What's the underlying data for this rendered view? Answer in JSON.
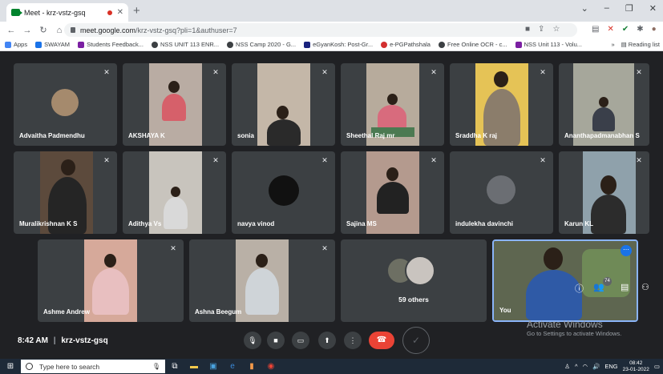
{
  "browser": {
    "tab_title": "Meet - krz-vstz-gsq",
    "url_main": "meet.google.com",
    "url_tail": "/krz-vstz-gsq?pli=1&authuser=7",
    "window_controls": [
      "⌄",
      "–",
      "❐",
      "✕"
    ],
    "bookmarks": [
      {
        "label": "Apps",
        "color": "#4285f4"
      },
      {
        "label": "SWAYAM",
        "color": "#1a73e8"
      },
      {
        "label": "Students Feedback...",
        "color": "#7b1fa2"
      },
      {
        "label": "NSS UNIT 113 ENR...",
        "color": "#3c4043"
      },
      {
        "label": "NSS Camp 2020 - G...",
        "color": "#3c4043"
      },
      {
        "label": "eGyanKosh: Post-Gr...",
        "color": "#1a237e"
      },
      {
        "label": "e-PGPathshala",
        "color": "#d32f2f"
      },
      {
        "label": "Free Online OCR - c...",
        "color": "#3c4043"
      },
      {
        "label": "NSS Unit 113 - Volu...",
        "color": "#7b1fa2"
      }
    ],
    "bookmarks_more": "»",
    "reading_list": "Reading list"
  },
  "participants": [
    {
      "name": "Advaitha Padmendhu"
    },
    {
      "name": "AKSHAYA K"
    },
    {
      "name": "sonia"
    },
    {
      "name": "Sheethal Raj mr"
    },
    {
      "name": "Sraddha K raj"
    },
    {
      "name": "Ananthapadmanabhan S"
    },
    {
      "name": "Muralikrishnan K S"
    },
    {
      "name": "Adithya Vs"
    },
    {
      "name": "navya vinod"
    },
    {
      "name": "Sajina MS"
    },
    {
      "name": "indulekha davinchi"
    },
    {
      "name": "Karun KL"
    },
    {
      "name": "Ashme Andrew"
    },
    {
      "name": "Ashna Beegum"
    },
    {
      "name": "59 others"
    },
    {
      "name": "You"
    }
  ],
  "meeting": {
    "time": "8:42 AM",
    "separator": "|",
    "code": "krz-vstz-gsq",
    "people_count": "74"
  },
  "watermark": {
    "title": "Activate Windows",
    "subtitle": "Go to Settings to activate Windows."
  },
  "taskbar": {
    "search_placeholder": "Type here to search",
    "language": "ENG",
    "time": "08:42",
    "date": "23-01-2022"
  }
}
